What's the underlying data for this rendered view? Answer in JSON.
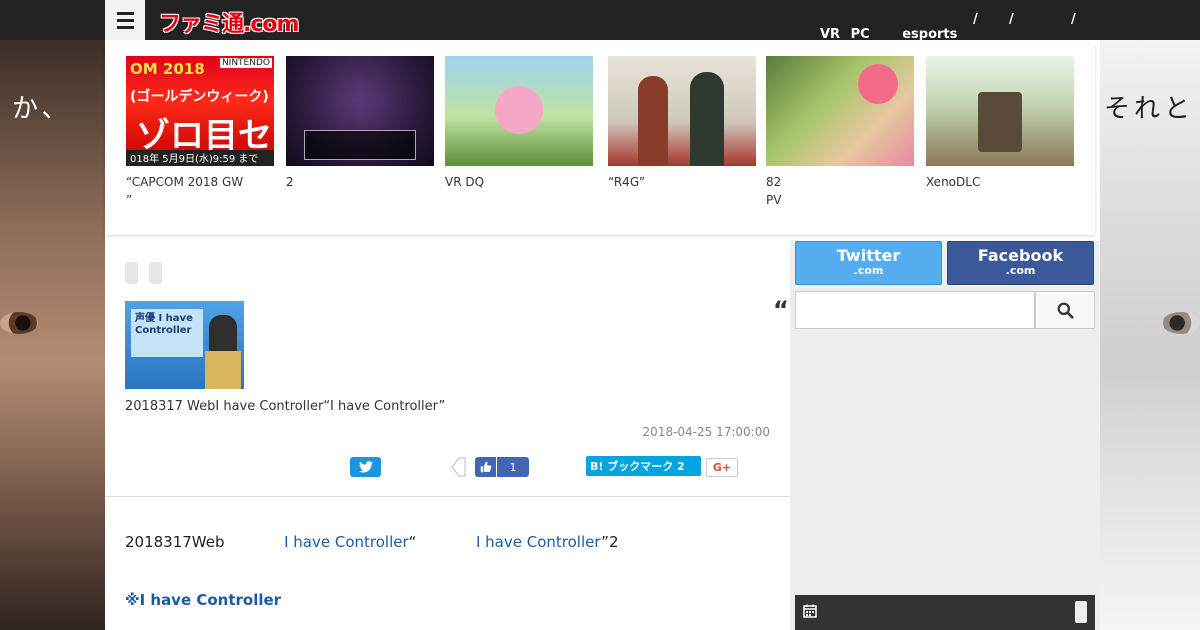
{
  "site": {
    "logo": "ファミ通.com",
    "nav": {
      "item1": "VR",
      "item2": "PC",
      "item3": "esports",
      "slash": "/"
    }
  },
  "background": {
    "left_text": "か、",
    "right_text": "それと"
  },
  "carousel": [
    {
      "caption": "“CAPCOM 2018 GW\n”",
      "thumb_lines": [
        "OM 2018",
        "(ゴールデンウィーク)",
        "ゾロ目セ",
        "018年 5月9日(水)9:59 まで"
      ],
      "thumb_badge": "NINTENDO"
    },
    {
      "caption": "2"
    },
    {
      "caption": "VR DQ"
    },
    {
      "caption": "“R4G”"
    },
    {
      "caption": "   82\nPV"
    },
    {
      "caption": "XenoDLC"
    }
  ],
  "article": {
    "thumb_text": "声優 I have Controller",
    "summary": "2018317 WebI have Controller“I have Controller”",
    "date": "2018-04-25 17:00:00",
    "share": {
      "like_count": "1",
      "hatena_label": "B! ブックマーク 2",
      "gplus_label": "G+"
    },
    "body_prefix": "2018317Web",
    "body_link1": "I have Controller",
    "body_mid": "“",
    "body_link2": "I have Controller",
    "body_suffix": "”2",
    "section_heading": "※I have Controller",
    "title_peek": "“I"
  },
  "sidebar": {
    "twitter_label": "Twitter",
    "twitter_sub": ".com",
    "facebook_label": "Facebook",
    "facebook_sub": ".com",
    "search_placeholder": ""
  },
  "colors": {
    "topbar": "#222222",
    "logo_red": "#e60012",
    "link_blue": "#1e5b9e",
    "twitter": "#55acee",
    "facebook": "#3b5998",
    "hatena": "#00a4de"
  }
}
